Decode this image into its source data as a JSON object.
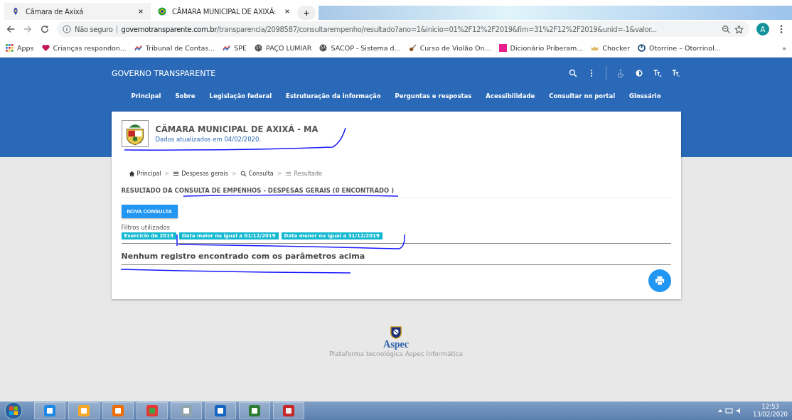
{
  "browser": {
    "tabs": [
      {
        "title": "Câmara de Axixá",
        "selected": false
      },
      {
        "title": "CÂMARA MUNICIPAL DE AXIXÁ:",
        "selected": true
      }
    ],
    "new_tab": "+",
    "address": {
      "security": "Não seguro",
      "domain": "governotransparente.com.br",
      "path": "/transparencia/2098587/consultarempenho/resultado?ano=1&inicio=01%2F12%2F2019&fim=31%2F12%2F2019&unid=-1&valor..."
    },
    "profile": "A",
    "bookmarks": [
      {
        "label": "Apps",
        "kind": "grid"
      },
      {
        "label": "Crianças respondon...",
        "kind": "heart"
      },
      {
        "label": "Tribunal de Contas...",
        "kind": "chart"
      },
      {
        "label": "SPE",
        "kind": "chart"
      },
      {
        "label": "PAÇO LUMIAR",
        "kind": "globe"
      },
      {
        "label": "SACOP - Sistema d...",
        "kind": "globe"
      },
      {
        "label": "Curso de Violão On...",
        "kind": "guitar"
      },
      {
        "label": "Dicionário Priberam...",
        "kind": "square"
      },
      {
        "label": "Chocker",
        "kind": "crown"
      },
      {
        "label": "Otorrine – Otorrinol...",
        "kind": "ring"
      }
    ],
    "more": "»"
  },
  "site": {
    "brand": "GOVERNO TRANSPARENTE",
    "nav": [
      "Principal",
      "Sobre",
      "Legislação federal",
      "Estruturação da informação",
      "Perguntas e respostas",
      "Acessibilidade",
      "Consultar no portal",
      "Glossário"
    ]
  },
  "org": {
    "name": "CÂMARA MUNICIPAL DE AXIXÁ - MA",
    "updated": "Dados atualizados em 04/02/2020."
  },
  "breadcrumb": [
    {
      "label": "Principal",
      "kind": "home"
    },
    {
      "label": "Despesas gerais",
      "kind": "list"
    },
    {
      "label": "Consulta",
      "kind": "search"
    },
    {
      "label": "Resultado",
      "kind": "result"
    }
  ],
  "breadcrumb_separator": ">",
  "result_title": "RESULTADO DA CONSULTA DE EMPENHOS - DESPESAS GERAIS (0 ENCONTRADO )",
  "new_query_button": "NOVA CONSULTA",
  "filters_label": "Filtros utilizados",
  "filters": [
    "Exercício de 2019",
    "Data maior ou igual a 01/12/2019",
    "Data menor ou igual a 31/12/2019"
  ],
  "empty_message": "Nenhum registro encontrado com os parâmetros acima",
  "footer": {
    "logo_text": "Aspec",
    "caption": "Plataforma tecnológica Aspec Informática"
  },
  "taskbar": {
    "time": "12:53",
    "date": "13/02/2020"
  }
}
